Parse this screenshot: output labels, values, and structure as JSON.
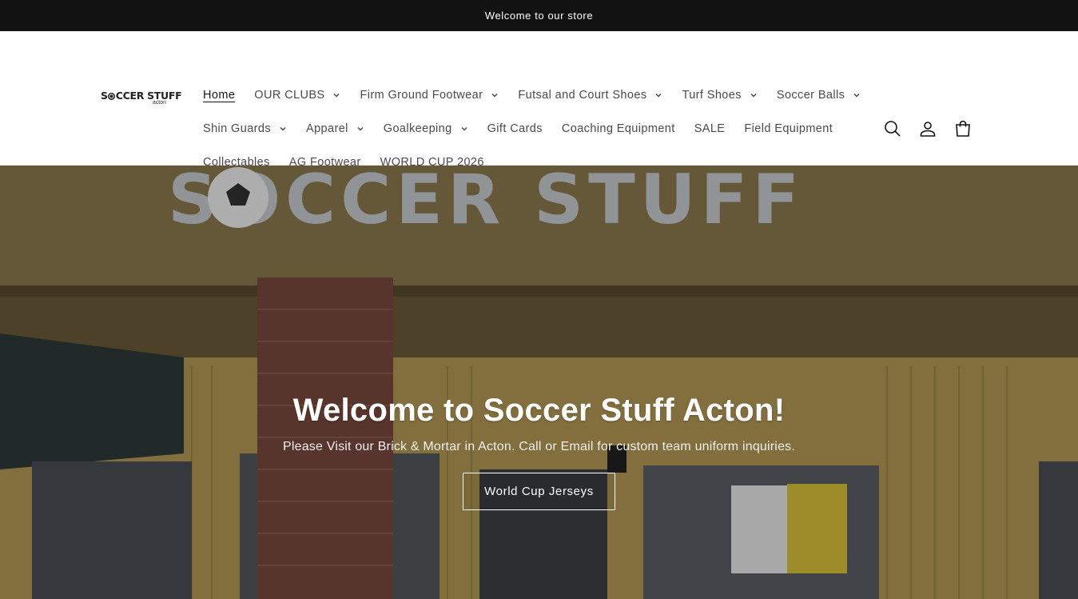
{
  "announcement": {
    "text": "Welcome to our store"
  },
  "logo": {
    "main": "SOCCER STUFF",
    "sub": "acton"
  },
  "nav": {
    "rows": [
      [
        {
          "label": "Home",
          "dropdown": false,
          "active": true
        },
        {
          "label": "OUR CLUBS",
          "dropdown": true
        },
        {
          "label": "Firm Ground Footwear",
          "dropdown": true
        },
        {
          "label": "Futsal and Court Shoes",
          "dropdown": true
        },
        {
          "label": "Turf Shoes",
          "dropdown": true
        },
        {
          "label": "Soccer Balls",
          "dropdown": true
        }
      ],
      [
        {
          "label": "Shin Guards",
          "dropdown": true
        },
        {
          "label": "Apparel",
          "dropdown": true
        },
        {
          "label": "Goalkeeping",
          "dropdown": true
        },
        {
          "label": "Gift Cards",
          "dropdown": false
        },
        {
          "label": "Coaching Equipment",
          "dropdown": false
        },
        {
          "label": "SALE",
          "dropdown": false
        },
        {
          "label": "Field Equipment",
          "dropdown": false
        }
      ],
      [
        {
          "label": "Collectables",
          "dropdown": false
        },
        {
          "label": "AG Footwear",
          "dropdown": false
        },
        {
          "label": "WORLD CUP 2026",
          "dropdown": false
        }
      ]
    ]
  },
  "header_icons": [
    "search-icon",
    "account-icon",
    "cart-icon"
  ],
  "hero": {
    "title": "Welcome to Soccer Stuff Acton!",
    "subtitle": "Please Visit our Brick & Mortar in Acton. Call or Email for custom team uniform inquiries.",
    "button_label": "World Cup Jerseys",
    "sign_text": "SOCCER STUFF"
  },
  "colors": {
    "announcement_bg": "#121212",
    "text": "#121212",
    "nav_text": "#4a4a4a"
  }
}
